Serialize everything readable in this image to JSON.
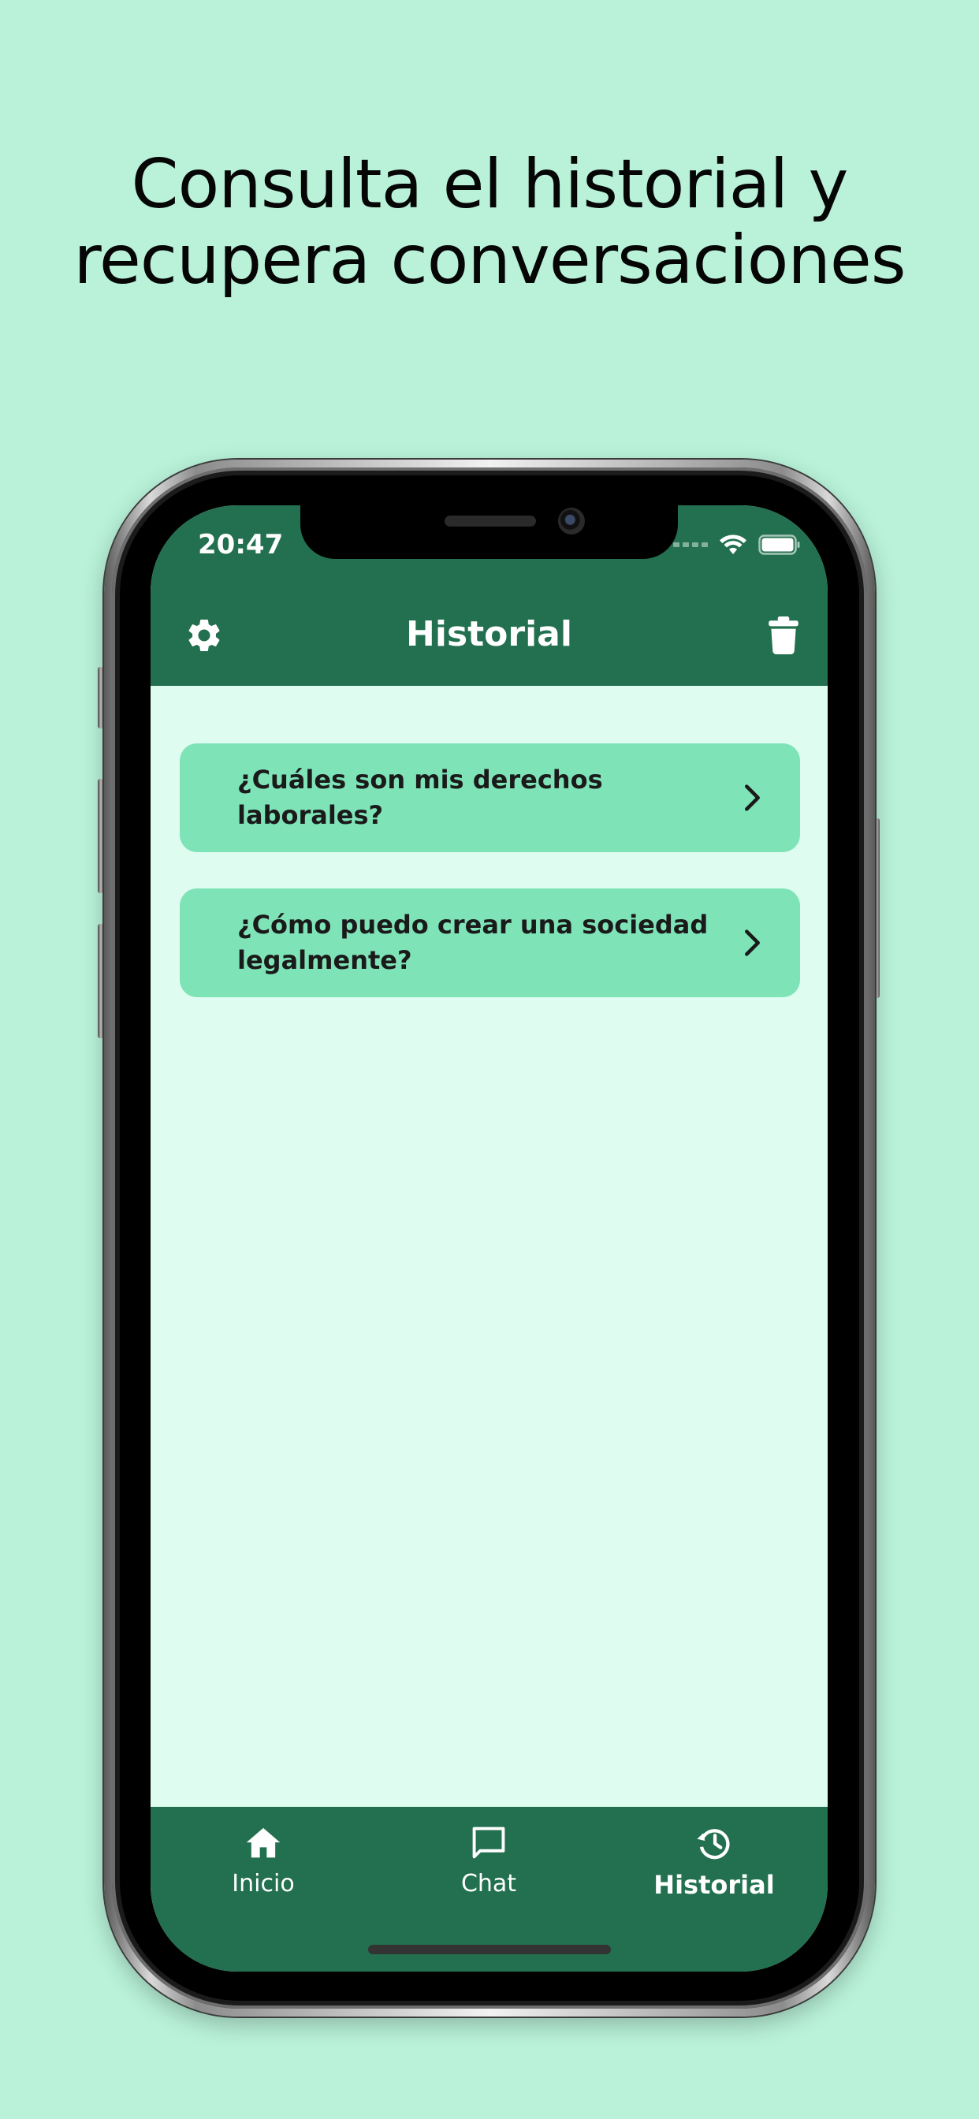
{
  "headline": {
    "line1": "Consulta el historial y",
    "line2": "recupera conversaciones"
  },
  "status_bar": {
    "time": "20:47",
    "icons": [
      "cellular-signal-icon",
      "wifi-icon",
      "battery-icon"
    ]
  },
  "app_bar": {
    "title": "Historial",
    "left_icon": "gear-icon",
    "right_icon": "trash-icon"
  },
  "history": {
    "items": [
      {
        "label": "¿Cuáles son mis derechos laborales?",
        "icon": "chevron-right-icon"
      },
      {
        "label": "¿Cómo puedo crear una sociedad legalmente?",
        "icon": "chevron-right-icon"
      }
    ]
  },
  "bottom_nav": {
    "items": [
      {
        "label": "Inicio",
        "icon": "home-icon",
        "active": false
      },
      {
        "label": "Chat",
        "icon": "chat-bubble-icon",
        "active": false
      },
      {
        "label": "Historial",
        "icon": "history-icon",
        "active": true
      }
    ]
  },
  "colors": {
    "page_background": "#b9f2d9",
    "primary_green": "#22704f",
    "screen_background": "#defdf0",
    "card_background": "#7fe3b8",
    "text_dark": "#1a1a1a",
    "text_light": "#ffffff"
  }
}
